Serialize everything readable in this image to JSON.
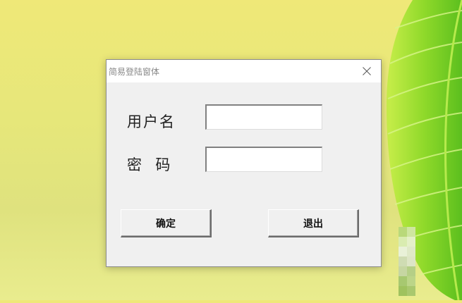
{
  "window": {
    "title": "简易登陆窗体"
  },
  "form": {
    "username_label": "用户名",
    "password_label": "密  码",
    "username_value": "",
    "password_value": ""
  },
  "buttons": {
    "ok_label": "确定",
    "exit_label": "退出"
  },
  "icons": {
    "close": "close-icon"
  },
  "colors": {
    "leaf_green": "#8fd92a",
    "dialog_bg": "#f0f0f0"
  }
}
